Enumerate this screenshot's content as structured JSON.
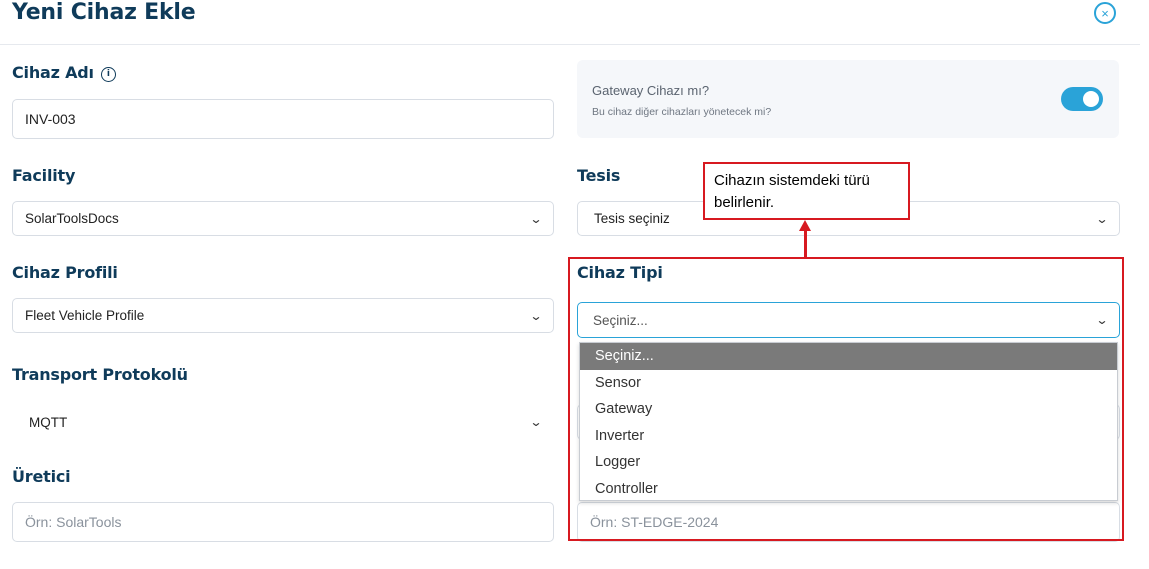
{
  "header": {
    "title": "Yeni Cihaz Ekle",
    "close_icon": "×"
  },
  "device_name": {
    "label": "Cihaz Adı",
    "info_icon": "i",
    "value": "INV-003"
  },
  "gateway": {
    "title": "Gateway Cihazı mı?",
    "subtitle": "Bu cihaz diğer cihazları yönetecek mi?",
    "enabled": true,
    "accent_color": "#2aa3d8"
  },
  "facility": {
    "label": "Facility",
    "value": "SolarToolsDocs"
  },
  "tesis": {
    "label": "Tesis",
    "value": "Tesis seçiniz"
  },
  "device_profile": {
    "label": "Cihaz Profili",
    "value": "Fleet Vehicle Profile"
  },
  "device_type": {
    "label": "Cihaz Tipi",
    "value": "Seçiniz...",
    "options": [
      "Seçiniz...",
      "Sensor",
      "Gateway",
      "Inverter",
      "Logger",
      "Controller"
    ]
  },
  "transport": {
    "label": "Transport Protokolü",
    "value": "MQTT"
  },
  "manufacturer": {
    "label": "Üretici",
    "placeholder": "Örn: SolarTools"
  },
  "model": {
    "placeholder": "Örn: ST-EDGE-2024"
  },
  "annotation": {
    "text": "Cihazın sistemdeki türü belirlenir.",
    "color": "#d71920"
  },
  "chevron": "⌄"
}
